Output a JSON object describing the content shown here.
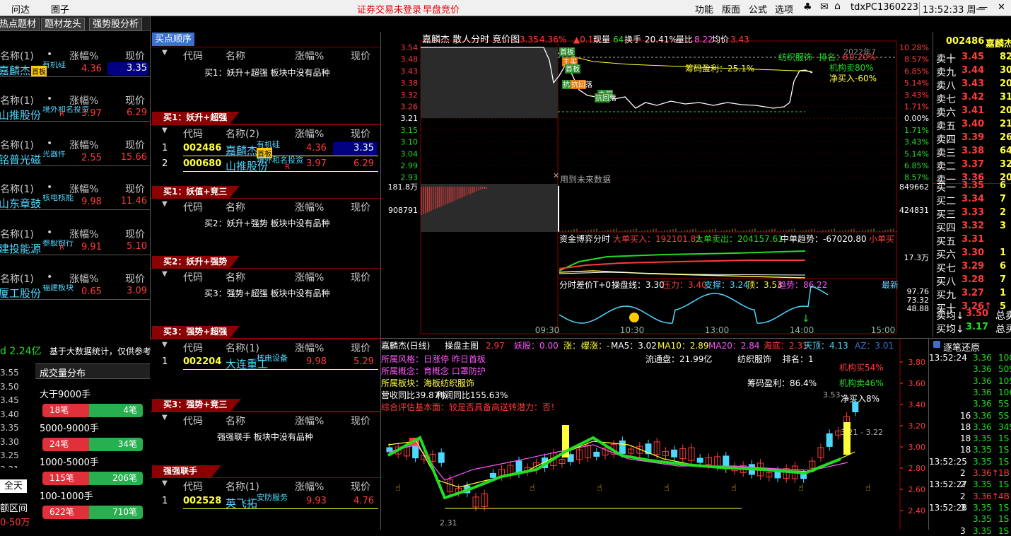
{
  "titlebar": {
    "menu1": "问达",
    "menu2": "圈子",
    "status1": "证券交易未登录",
    "status2": "早盘竞价",
    "right": [
      "功能",
      "版面",
      "公式",
      "选项"
    ],
    "host": "tdxPC1360223",
    "time": "13:52:33 周一"
  },
  "tabs": [
    "热点题材",
    "题材龙头",
    "强势股分析"
  ],
  "left_blocks": [
    {
      "head": [
        "名称(1)",
        "•",
        "涨幅%",
        "现价"
      ],
      "name": "嘉麟杰",
      "tag": "有机硅",
      "badge": "首板",
      "chg": "4.36",
      "price": "3.35"
    },
    {
      "head": [
        "名称(1)",
        "•",
        "涨幅%",
        "现价"
      ],
      "name": "山推股份",
      "tag": "境外和名投资",
      "badge": "R",
      "chg": "3.97",
      "price": "6.29"
    },
    {
      "head": [
        "名称(1)",
        "•",
        "涨幅%",
        "现价"
      ],
      "name": "铭普光磁",
      "tag": "光器件",
      "badge": "",
      "chg": "2.55",
      "price": "15.66"
    },
    {
      "head": [
        "名称(1)",
        "•",
        "涨幅%",
        "现价"
      ],
      "name": "山东章鼓",
      "tag": "核电核能",
      "badge": "",
      "chg": "9.98",
      "price": "11.46"
    },
    {
      "head": [
        "名称(1)",
        "•",
        "涨幅%",
        "现价"
      ],
      "name": "建投能源",
      "tag": "参股银行",
      "badge": "R",
      "chg": "9.91",
      "price": "5.10"
    },
    {
      "head": [
        "名称(1)",
        "•",
        "涨幅%",
        "现价"
      ],
      "name": "厦工股份",
      "tag": "福建板块",
      "badge": "",
      "chg": "0.65",
      "price": "3.09"
    }
  ],
  "leftbottom": {
    "amount": "d 2.24亿",
    "note": "基于大数据统计，仅供参考",
    "dist_title": "成交量分布",
    "prices": [
      "3.55",
      "3.50",
      "3.45",
      "3.40",
      "3.35",
      "3.30",
      "3.25",
      "3.21"
    ],
    "rows": [
      {
        "label": "大于9000手",
        "buy": "18笔",
        "sell": "4笔"
      },
      {
        "label": "5000-9000手",
        "buy": "24笔",
        "sell": "34笔"
      },
      {
        "label": "1000-5000手",
        "buy": "115笔",
        "sell": "206笔"
      },
      {
        "label": "100-1000手",
        "buy": "622笔",
        "sell": "710笔"
      }
    ],
    "btn_all": "全天",
    "range": "额区间",
    "range_val": "0-50万"
  },
  "mid": {
    "title": "买点顺序",
    "head": [
      "代码",
      "名称",
      "涨幅%",
      "现价"
    ],
    "s1_note": "买1：妖升+超强 板块中没有品种",
    "b1": "买1：妖升+超强",
    "s2_head_name": "名称(2)",
    "s2_rows": [
      {
        "i": "1",
        "code": "002486",
        "name": "嘉麟杰",
        "tag": "有机硅",
        "badge": "首板",
        "chg": "4.36",
        "price": "3.35"
      },
      {
        "i": "2",
        "code": "000680",
        "name": "山推股份",
        "tag": "境外和名投资",
        "badge": "R",
        "chg": "3.97",
        "price": "6.29"
      }
    ],
    "b2": "买1：妖值+竞三",
    "s3_note": "买2：妖升+强势 板块中没有品种",
    "b3": "买2：妖升+强势",
    "s4_note": "买3：强势+超强 板块中没有品种",
    "b4": "买3：强势+超强",
    "s5_head_name": "名称(1)",
    "s5_row": {
      "i": "1",
      "code": "002204",
      "name": "大连重工",
      "tag": "核电设备",
      "chg": "9.98",
      "price": "5.29"
    },
    "b5": "买3：强势+竞三",
    "s6_note": "强强联手 板块中没有品种",
    "b6": "强强联手",
    "s7_head_name": "名称(1)",
    "s7_row": {
      "i": "1",
      "code": "002528",
      "name": "英飞拓",
      "tag": "安防服务",
      "chg": "9.93",
      "price": "4.76"
    }
  },
  "intraday": {
    "header": "嘉麟杰  散人分时 竞价图",
    "price": "3.35",
    "pct": "4.36%",
    "delta": "▲0.14",
    "vol_label": "现量",
    "vol": "64",
    "turn_label": "换手",
    "turn": "20.41%",
    "ratio_label": "量比",
    "ratio": "8.22",
    "avg_label": "均价",
    "avg": "3.43",
    "yticks": [
      "3.54",
      "3.48",
      "3.43",
      "3.38",
      "3.32",
      "3.26",
      "3.21",
      "3.15",
      "3.10",
      "3.04",
      "2.99",
      "2.93"
    ],
    "pticks": [
      "10.28%",
      "8.57%",
      "6.85%",
      "5.14%",
      "3.43%",
      "1.71%",
      "0.00%",
      "1.71%",
      "3.43%",
      "5.14%",
      "6.85%",
      "8.57%"
    ],
    "year": "2022年7",
    "industry": "纺织服饰",
    "rank_label": "排名：",
    "rank": "8",
    "rank2": "0.20%",
    "inst_label": "机构卖80%",
    "net_label": "净买入-60%",
    "chip": "筹码盈利：25.1%",
    "future": "用到未来数据",
    "vol_l": [
      "181.8万",
      "908791"
    ],
    "vol_r": [
      "849662",
      "424831"
    ],
    "fund_title": "资金博弈分时",
    "big_buy": "大单买入：192101.82",
    "big_sell": "大单卖出：204157.61",
    "mid_trend": "中单趋势：-67020.80",
    "small": "小单买",
    "fund_r": "17.3万",
    "diff_title": "分时差价T+0",
    "line_label": "操盘线：3.30",
    "press": "压力：3.40",
    "support": "支撑：3.24",
    "top": "顶：3.53",
    "trend": "趋势：86.22",
    "newest": "最新",
    "diff_r": [
      "97.76",
      "73.32",
      "48.88"
    ],
    "times": [
      "09:30",
      "10:30",
      "13:00",
      "14:00",
      "15:00"
    ],
    "marks": [
      "首板",
      "主买",
      "首板",
      "抗回落",
      "抗回落",
      "主买",
      "抗回落"
    ]
  },
  "daily": {
    "title": "嘉麟杰(日线)",
    "menu": "操盘主图",
    "v1": "2.97",
    "yao": "妖股：0.00",
    "zhang": "涨：-",
    "bao": "爆涨：-",
    "ma5": "MA5：3.02",
    "ma10": "MA10：2.89",
    "ma20": "MA20：2.84",
    "hai": "海底：2.31",
    "tian": "天顶：4.13",
    "az": "AZ：3.01",
    "risk": "所属风格：日涨停 昨日首板",
    "concept": "所属概念：育概念 口罩防护",
    "sector": "所属板块：海板纺织服饰",
    "rev": "营收同比39.87%",
    "profit": "利润同比155.63%",
    "eval": "综合评估基本面：较是否具备高送转潜力：否！",
    "float": "流通盘：21.99亿",
    "industry": "纺织服饰",
    "rank": "排名：1",
    "inst_buy": "机构买54%",
    "chip": "筹码盈利：86.4%",
    "inst_sell": "机构卖46%",
    "net": "净买入8%",
    "hi": "3.53",
    "band": "3.21 - 3.22",
    "low": "2.31",
    "yticks": [
      "3.80",
      "3.60",
      "3.40",
      "3.20",
      "3.00",
      "2.80",
      "2.60",
      "2.40"
    ]
  },
  "orderbook": {
    "code": "002486",
    "name": "嘉麟杰",
    "asks": [
      {
        "l": "卖十",
        "p": "3.45",
        "v": "82"
      },
      {
        "l": "卖九",
        "p": "3.44",
        "v": "30"
      },
      {
        "l": "卖八",
        "p": "3.43",
        "v": "20"
      },
      {
        "l": "卖七",
        "p": "3.42",
        "v": "31"
      },
      {
        "l": "卖六",
        "p": "3.41",
        "v": "20"
      },
      {
        "l": "卖五",
        "p": "3.40",
        "v": "21"
      },
      {
        "l": "卖四",
        "p": "3.39",
        "v": "26"
      },
      {
        "l": "卖三",
        "p": "3.38",
        "v": "64"
      },
      {
        "l": "卖二",
        "p": "3.37",
        "v": "32"
      },
      {
        "l": "卖一",
        "p": "3.36",
        "v": "20"
      }
    ],
    "bids": [
      {
        "l": "买一",
        "p": "3.35",
        "v": "6"
      },
      {
        "l": "买二",
        "p": "3.34",
        "v": "7"
      },
      {
        "l": "买三",
        "p": "3.33",
        "v": "2"
      },
      {
        "l": "买四",
        "p": "3.32",
        "v": "3"
      },
      {
        "l": "买五",
        "p": "3.31",
        "v": ""
      },
      {
        "l": "买六",
        "p": "3.30",
        "v": "1"
      },
      {
        "l": "买七",
        "p": "3.29",
        "v": "6"
      },
      {
        "l": "买八",
        "p": "3.28",
        "v": "7"
      },
      {
        "l": "买九",
        "p": "3.27",
        "v": "1"
      },
      {
        "l": "买十",
        "p": "3.26↑",
        "v": "5"
      }
    ],
    "avg_sell": "卖均↓",
    "avg_sell_p": "3.50",
    "avg_sell_t": "总卖",
    "avg_buy": "买均↓",
    "avg_buy_p": "3.17",
    "avg_buy_t": "总买"
  },
  "ticks": {
    "title": "逐笔还原",
    "rows": [
      {
        "t": "13:52:24",
        "p": "3.36",
        "v": "100S"
      },
      {
        "t": "",
        "p": "3.36",
        "v": "50S"
      },
      {
        "t": "",
        "p": "3.36",
        "v": "10S"
      },
      {
        "t": "",
        "p": "3.36",
        "v": "106S"
      },
      {
        "t": "",
        "p": "3.36",
        "v": "5S"
      },
      {
        "t": "",
        "p": "3.36",
        "v": "5S"
      },
      {
        "t": "",
        "p": "3.36",
        "v": "34S"
      },
      {
        "t": "",
        "p": "3.35",
        "v": "1S"
      },
      {
        "t": "",
        "p": "3.35",
        "v": "1S"
      },
      {
        "t": "13:52:25",
        "p": "3.35",
        "v": "1S"
      },
      {
        "t": "",
        "p": "3.36↑",
        "v": "1B"
      },
      {
        "t": "13:52:27",
        "p": "3.35",
        "v": "1S"
      },
      {
        "t": "",
        "p": "3.36↑",
        "v": "4B"
      },
      {
        "t": "13:52:28",
        "p": "3.35",
        "v": "1S"
      },
      {
        "t": "",
        "p": "3.35",
        "v": "1S"
      },
      {
        "t": "",
        "p": "3.35",
        "v": "1S"
      }
    ],
    "qty": [
      "",
      "",
      "",
      "",
      "",
      "16",
      "18",
      "18",
      "18",
      "",
      "2",
      "2",
      "2",
      "3",
      "",
      "3"
    ]
  }
}
